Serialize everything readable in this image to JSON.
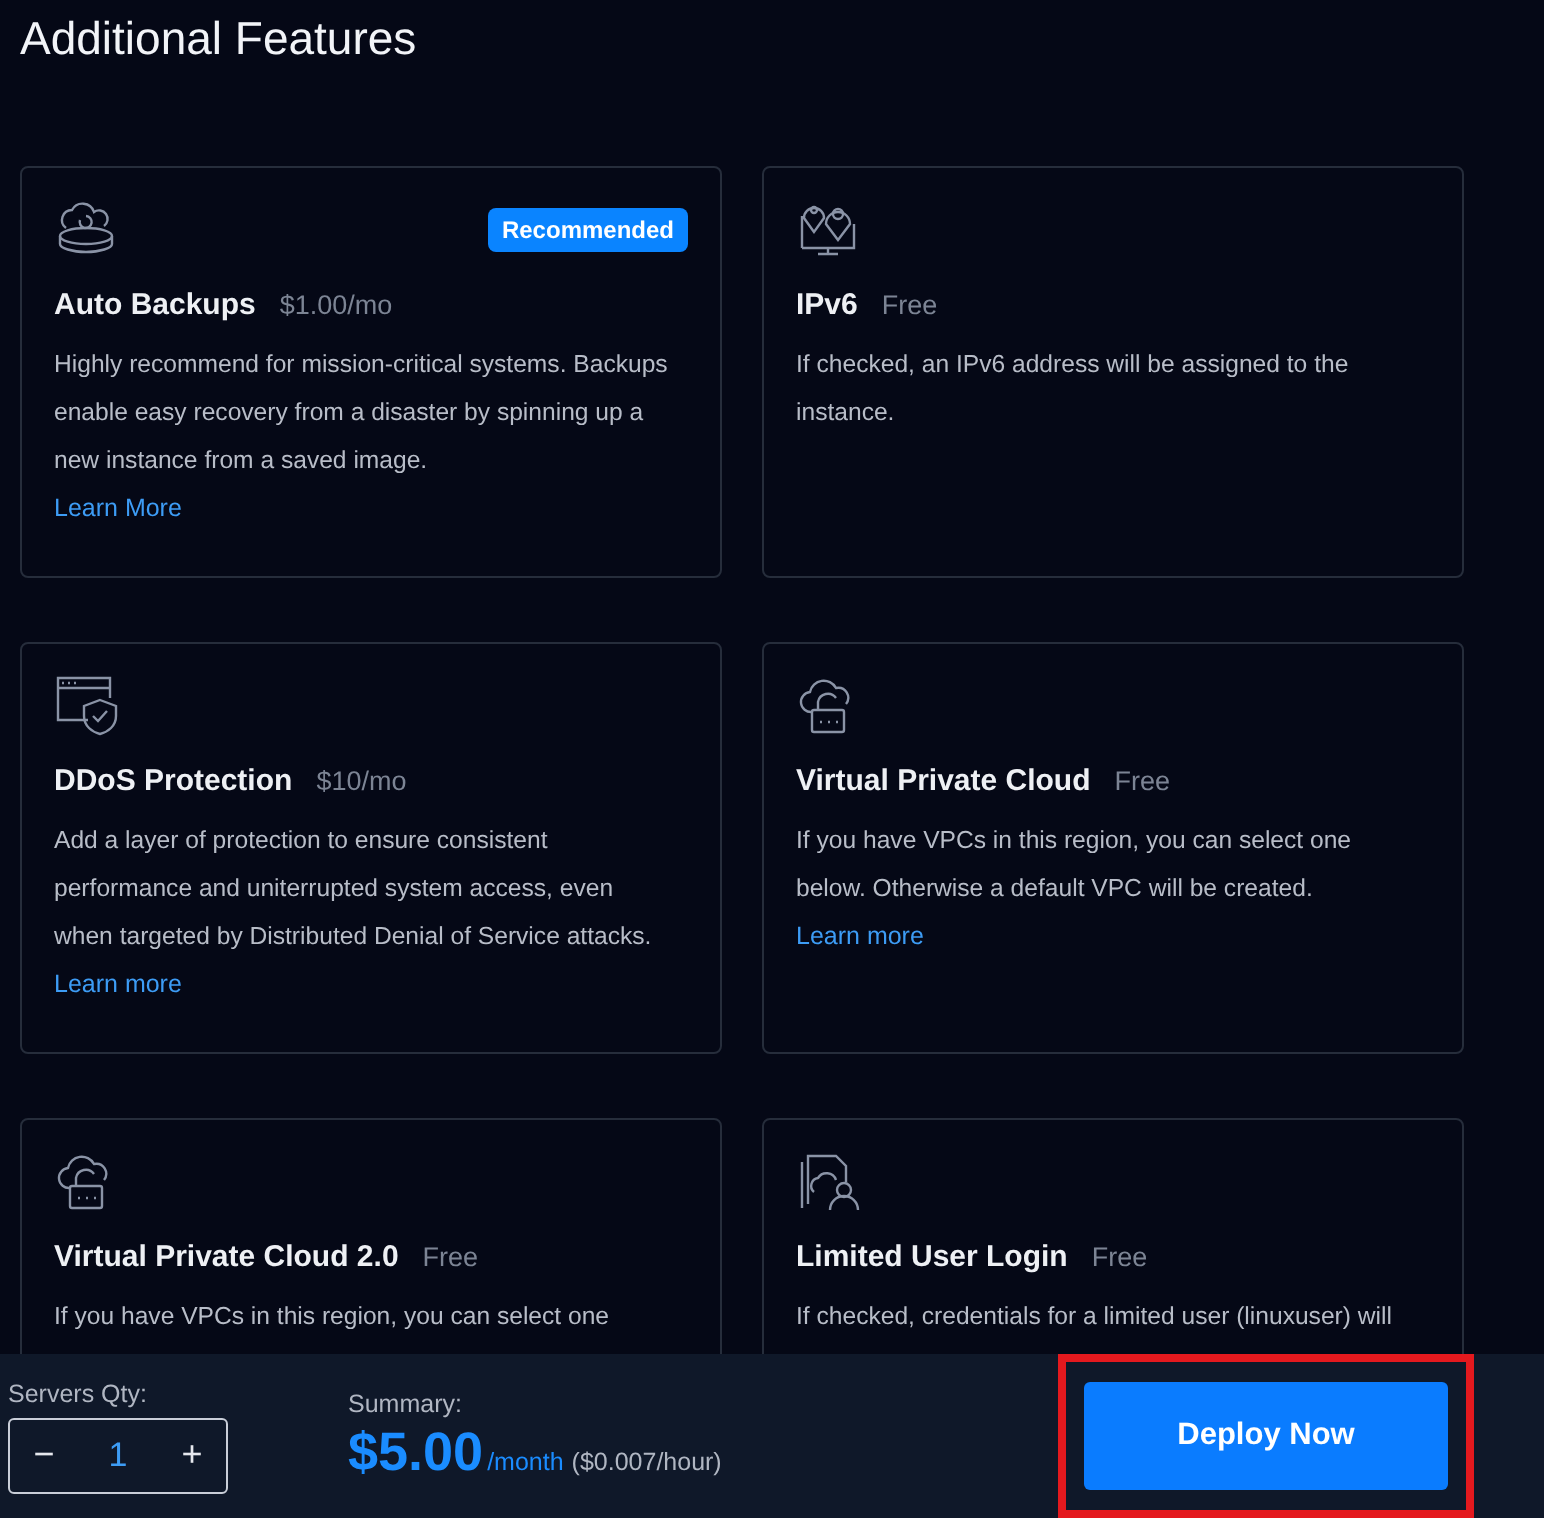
{
  "heading": "Additional Features",
  "features": [
    {
      "title": "Auto Backups",
      "price": "$1.00/mo",
      "badge": "Recommended",
      "description": "Highly recommend for mission-critical systems. Backups enable easy recovery from a disaster by spinning up a new instance from a saved image.",
      "link": "Learn More"
    },
    {
      "title": "IPv6",
      "price": "Free",
      "description": "If checked, an IPv6 address will be assigned to the instance."
    },
    {
      "title": "DDoS Protection",
      "price": "$10/mo",
      "description": "Add a layer of protection to ensure consistent performance and uniterrupted system access, even when targeted by Distributed Denial of Service attacks.",
      "link": "Learn more"
    },
    {
      "title": "Virtual Private Cloud",
      "price": "Free",
      "description": "If you have VPCs in this region, you can select one below. Otherwise a default VPC will be created.",
      "link": "Learn more"
    },
    {
      "title": "Virtual Private Cloud 2.0",
      "price": "Free",
      "description": "If you have VPCs in this region, you can select one"
    },
    {
      "title": "Limited User Login",
      "price": "Free",
      "description": "If checked, credentials for a limited user (linuxuser) will"
    }
  ],
  "footer": {
    "qty_label": "Servers Qty:",
    "minus": "−",
    "qty": "1",
    "plus": "+",
    "summary_label": "Summary:",
    "price": "$5.00",
    "period": "/month",
    "hourly": "($0.007/hour)",
    "deploy": "Deploy Now",
    "deploy_highlighted": true
  }
}
